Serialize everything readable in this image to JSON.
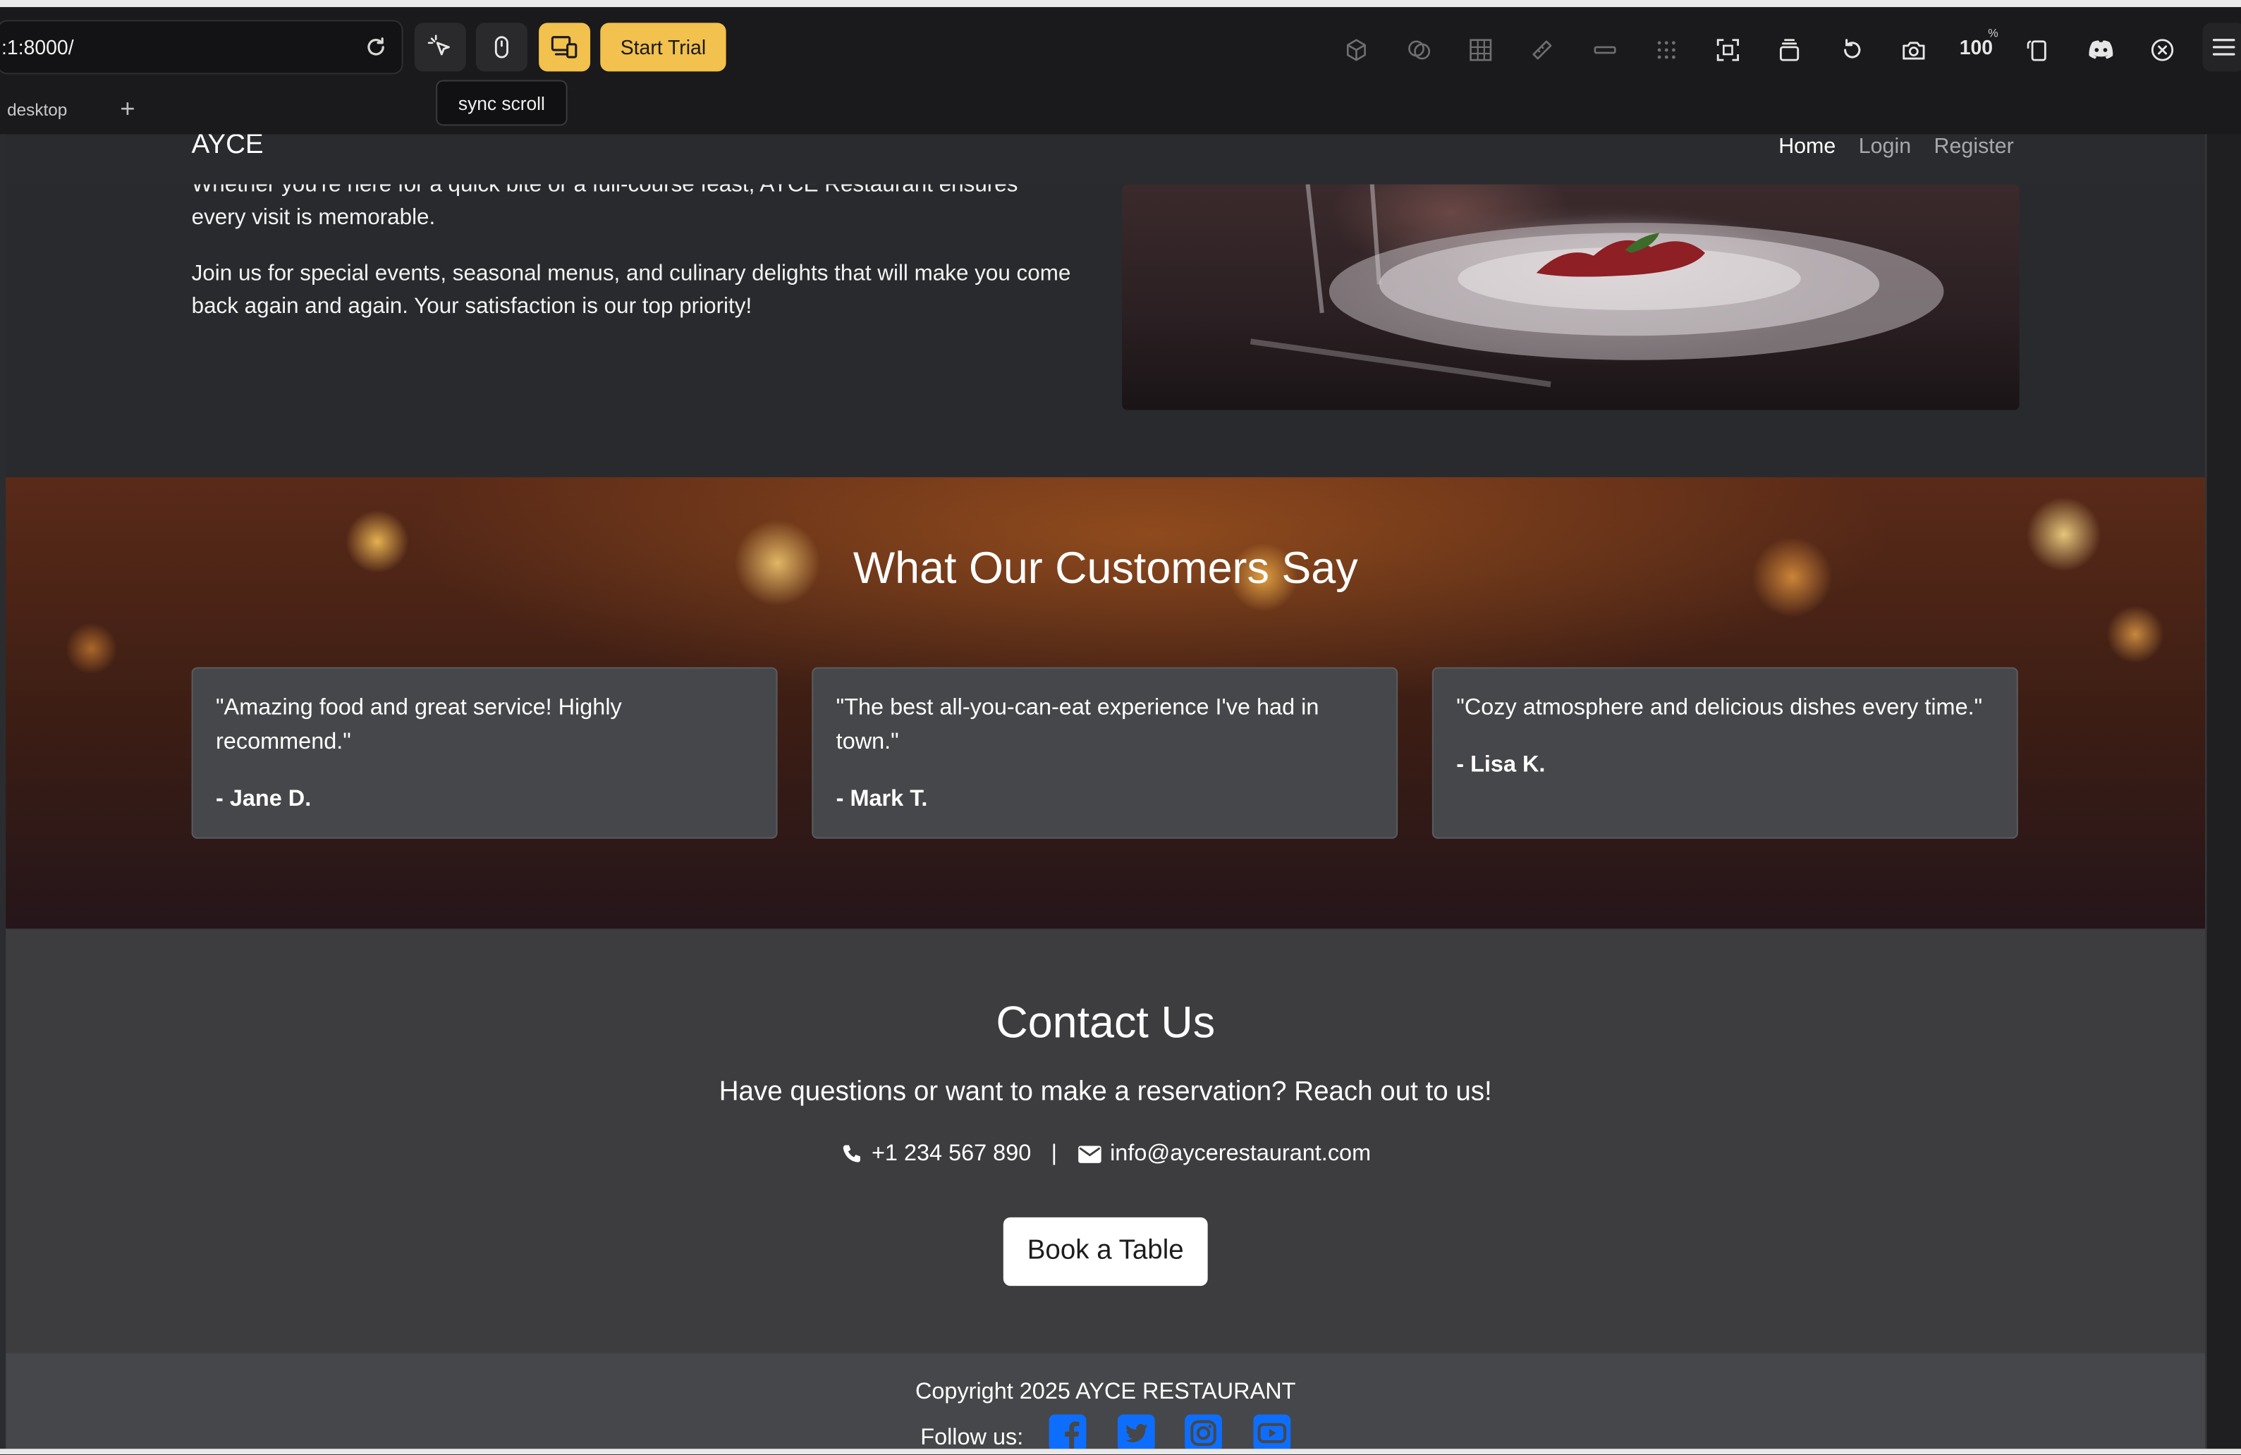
{
  "browser": {
    "url": ":1:8000/",
    "start_trial_label": "Start Trial",
    "zoom": "100",
    "zoom_unit": "%",
    "tab_label": "desktop",
    "tooltip": "sync scroll"
  },
  "site": {
    "brand": "AYCE",
    "nav": [
      {
        "label": "Home",
        "active": true
      },
      {
        "label": "Login",
        "active": false
      },
      {
        "label": "Register",
        "active": false
      }
    ],
    "about": {
      "paragraph_1": "Whether you're here for a quick bite or a full-course feast, AYCE Restaurant ensures every visit is memorable.",
      "paragraph_2": "Join us for special events, seasonal menus, and culinary delights that will make you come back again and again. Your satisfaction is our top priority!"
    },
    "testimonials": {
      "title": "What Our Customers Say",
      "items": [
        {
          "quote": "\"Amazing food and great service! Highly recommend.\"",
          "author": "- Jane D."
        },
        {
          "quote": "\"The best all-you-can-eat experience I've had in town.\"",
          "author": "- Mark T."
        },
        {
          "quote": "\"Cozy atmosphere and delicious dishes every time.\"",
          "author": "- Lisa K."
        }
      ]
    },
    "contact": {
      "title": "Contact Us",
      "subtitle": "Have questions or want to make a reservation? Reach out to us!",
      "phone": "+1 234 567 890",
      "separator": "|",
      "email": "info@aycerestaurant.com",
      "button": "Book a Table"
    },
    "footer": {
      "copyright": "Copyright 2025 AYCE RESTAURANT",
      "follow_label": "Follow us:",
      "social_icons": [
        "facebook-icon",
        "twitter-icon",
        "instagram-icon",
        "youtube-icon"
      ]
    }
  },
  "colors": {
    "accent": "#f2c14e",
    "social_blue": "#0d6efd",
    "page_bg": "#282a2e",
    "card_bg": "#46474a"
  }
}
